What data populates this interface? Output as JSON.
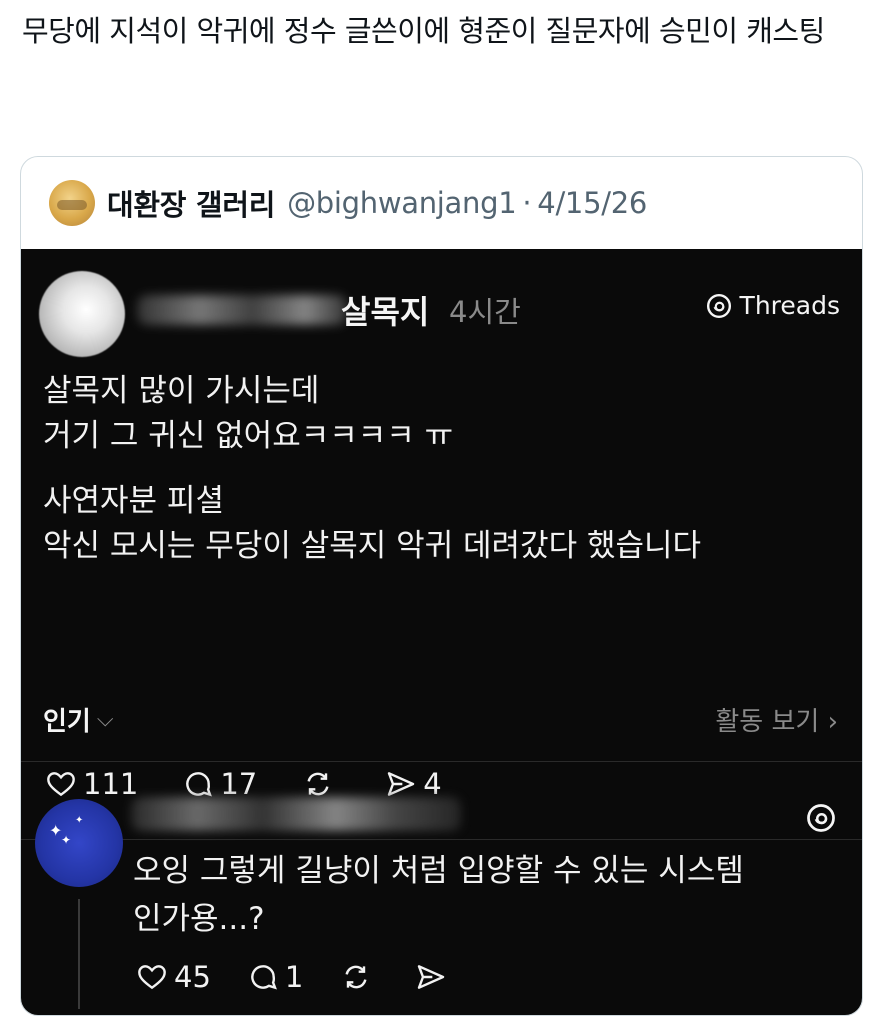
{
  "tweet": {
    "text": "무당에 지석이 악귀에 정수 글쓴이에 형준이 질문자에 승민이 캐스팅"
  },
  "quote": {
    "author_name": "대환장 갤러리",
    "handle": "@bighwanjang1",
    "separator": "·",
    "date": "4/15/26"
  },
  "threads_post": {
    "title": "살목지",
    "time": "4시간",
    "brand": "Threads",
    "body_lines_1": [
      "살목지 많이 가시는데",
      "거기 그 귀신 없어요ㅋㅋㅋㅋ ㅠ"
    ],
    "body_lines_2": [
      "사연자분 피셜",
      "악신 모시는 무당이 살목지 악귀 데려갔다 했습니다"
    ],
    "likes": "111",
    "comments": "17",
    "shares": "4",
    "sort_label": "인기",
    "activity_link": "활동 보기 ›"
  },
  "reply": {
    "lines": [
      "오잉 그렇게 길냥이 처럼 입양할 수 있는 시스템",
      "인가용...?"
    ],
    "likes": "45",
    "comments": "1"
  }
}
